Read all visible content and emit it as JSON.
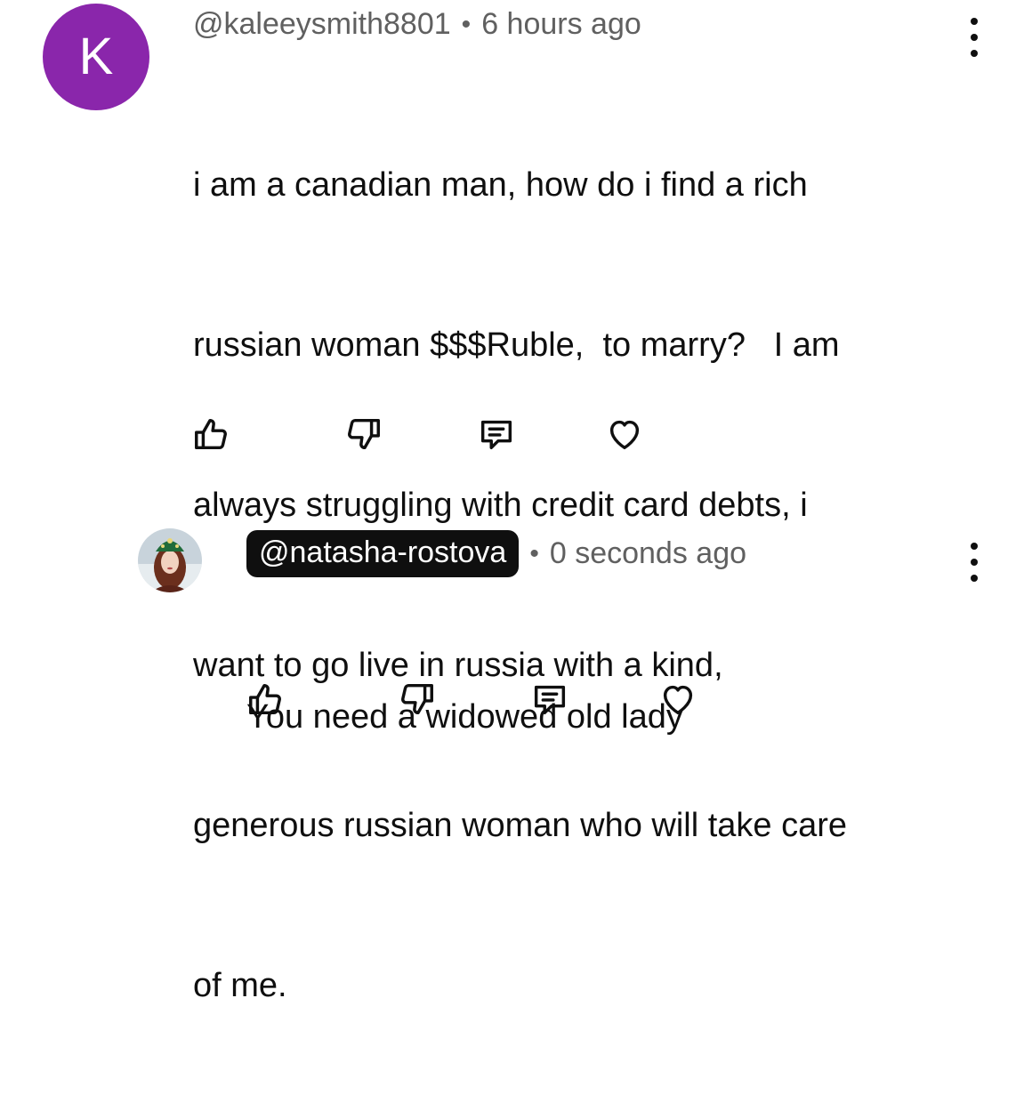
{
  "colors": {
    "avatar_k": "#8a26ab",
    "text_primary": "#0f0f0f",
    "text_secondary": "#606060",
    "handle_pill_bg": "#0f0f0f"
  },
  "comments": [
    {
      "avatar_letter": "K",
      "handle": "@kaleeysmith8801",
      "separator": "•",
      "time": "6 hours ago",
      "text_lines": [
        "i am a canadian man, how do i find a rich",
        "russian woman $$$Ruble,  to marry?   I am",
        "always struggling with credit card debts, i",
        "want to go live in russia with a kind,",
        "generous russian woman who will take care",
        "of me."
      ],
      "actions": [
        "thumbs-up-icon",
        "thumbs-down-icon",
        "reply-icon",
        "heart-icon"
      ],
      "menu_icon": "more-vertical-icon"
    },
    {
      "avatar_icon": "profile-photo",
      "handle": "@natasha-rostova",
      "separator": "•",
      "time": "0 seconds ago",
      "text_lines": [
        "You need a widowed old lady"
      ],
      "actions": [
        "thumbs-up-icon",
        "thumbs-down-icon",
        "reply-icon",
        "heart-icon"
      ],
      "menu_icon": "more-vertical-icon"
    }
  ]
}
